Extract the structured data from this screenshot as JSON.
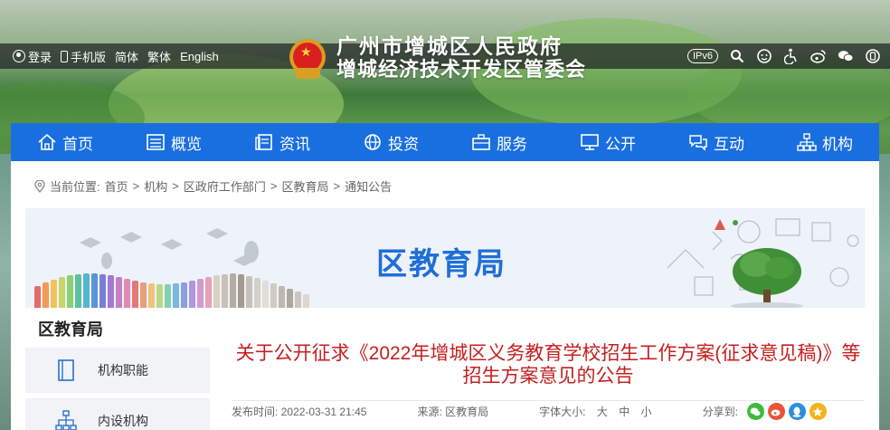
{
  "topbar": {
    "login": "登录",
    "mobile": "手机版",
    "simplified": "简体",
    "traditional": "繁体",
    "english": "English",
    "ipv6": "IPv6"
  },
  "brand": {
    "line1": "广州市增城区人民政府",
    "line2": "增城经济技术开发区管委会"
  },
  "nav": [
    {
      "label": "首页",
      "icon": "home-icon"
    },
    {
      "label": "概览",
      "icon": "list-icon"
    },
    {
      "label": "资讯",
      "icon": "news-icon"
    },
    {
      "label": "投资",
      "icon": "globe-icon"
    },
    {
      "label": "服务",
      "icon": "briefcase-icon"
    },
    {
      "label": "公开",
      "icon": "monitor-icon"
    },
    {
      "label": "互动",
      "icon": "chat-icon"
    },
    {
      "label": "机构",
      "icon": "org-icon"
    }
  ],
  "breadcrumb": {
    "prefix": "当前位置:",
    "items": [
      "首页",
      "机构",
      "区政府工作部门",
      "区教育局",
      "通知公告"
    ],
    "separator": ">"
  },
  "banner": {
    "title": "区教育局"
  },
  "sidebar": {
    "title": "区教育局",
    "items": [
      {
        "label": "机构职能",
        "icon": "book-icon"
      },
      {
        "label": "内设机构",
        "icon": "org-chart-icon"
      }
    ]
  },
  "article": {
    "title": "关于公开征求《2022年增城区义务教育学校招生工作方案(征求意见稿)》等招生方案意见的公告",
    "publish_label": "发布时间:",
    "publish_time": "2022-03-31 21:45",
    "source_label": "来源:",
    "source": "区教育局",
    "font_label": "字体大小:",
    "font_sizes": [
      "大",
      "中",
      "小"
    ],
    "share_label": "分享到:"
  },
  "colors": {
    "nav_bg": "#1a6fe0",
    "title_red": "#c41f1f",
    "banner_blue": "#1f6fd8"
  }
}
